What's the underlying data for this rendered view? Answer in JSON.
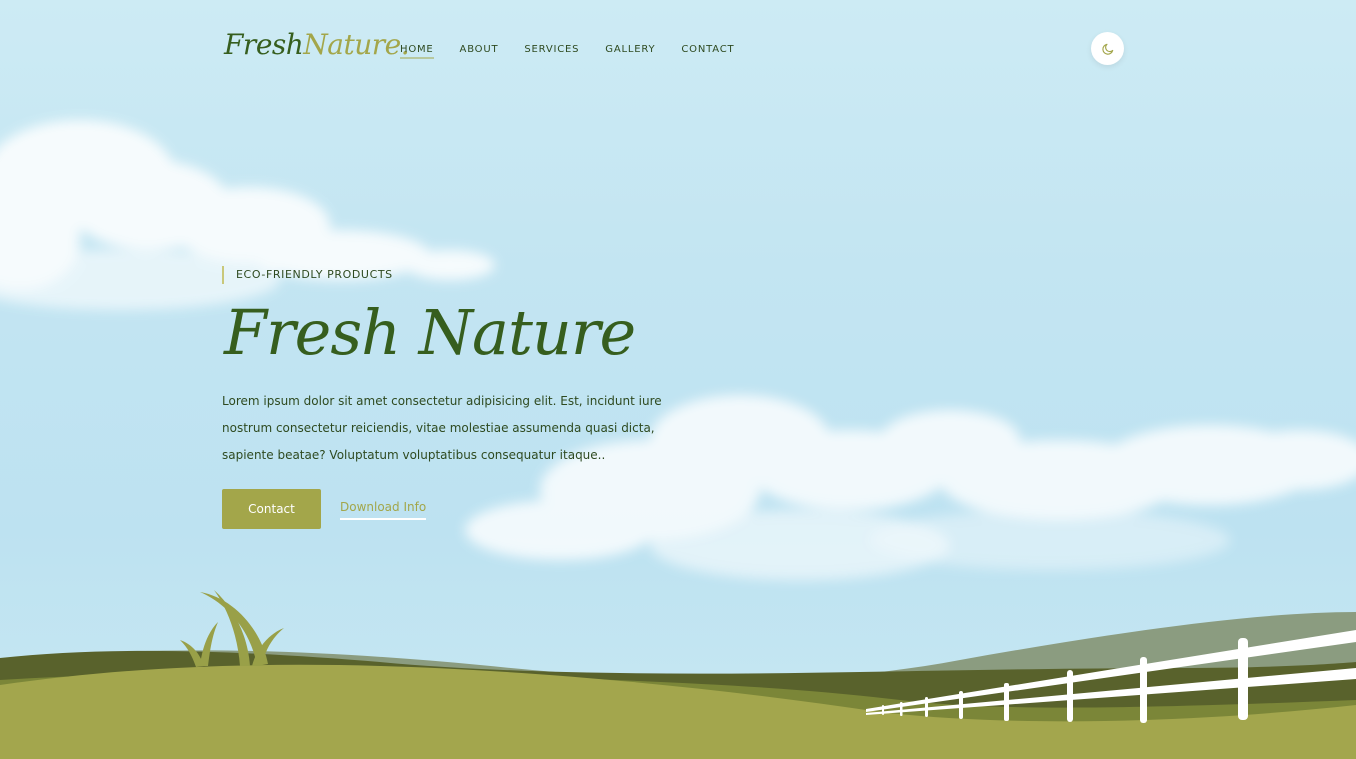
{
  "header": {
    "logo_part1": "Fresh",
    "logo_part2": "Nature.",
    "nav": [
      {
        "label": "HOME",
        "active": true
      },
      {
        "label": "ABOUT",
        "active": false
      },
      {
        "label": "SERVICES",
        "active": false
      },
      {
        "label": "GALLERY",
        "active": false
      },
      {
        "label": "CONTACT",
        "active": false
      }
    ],
    "theme_toggle_icon": "moon-icon"
  },
  "hero": {
    "eyebrow": "ECO-FRIENDLY PRODUCTS",
    "title": "Fresh Nature",
    "description": "Lorem ipsum dolor sit amet consectetur adipisicing elit. Est, incidunt iure nostrum consectetur reiciendis, vitae molestiae assumenda quasi dicta, sapiente beatae? Voluptatum voluptatibus consequatur itaque..",
    "primary_button": "Contact",
    "secondary_link": "Download Info"
  },
  "colors": {
    "accent": "#a3a64a",
    "dark_green": "#365e1e",
    "sky": "#c3e5f2",
    "text": "#2e4a20"
  }
}
